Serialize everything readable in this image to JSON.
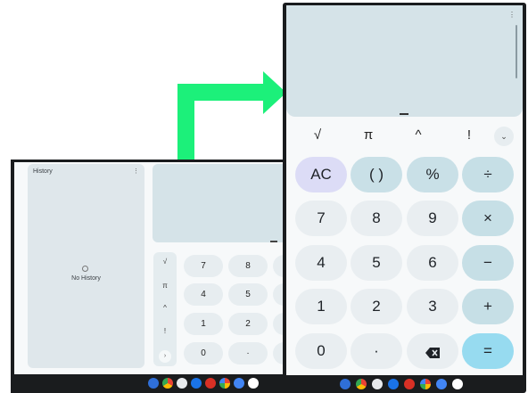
{
  "left_device": {
    "history": {
      "title": "History",
      "menu_icon": "more-vert-icon",
      "empty_icon": "history-icon",
      "empty_text": "No History"
    },
    "scientific": [
      "√",
      "π",
      "^",
      "!"
    ],
    "expand_icon": "chevron-right-icon",
    "expand_glyph": "›",
    "keys": [
      [
        "7",
        "8"
      ],
      [
        "4",
        "5"
      ],
      [
        "1",
        "2"
      ],
      [
        "0",
        "·"
      ]
    ]
  },
  "right_device": {
    "menu_glyph": "⋮",
    "scientific": [
      "√",
      "π",
      "^",
      "!"
    ],
    "collapse_glyph": "⌄",
    "keys": {
      "row1": [
        "AC",
        "( )",
        "%",
        "÷"
      ],
      "row2": [
        "7",
        "8",
        "9",
        "×"
      ],
      "row3": [
        "4",
        "5",
        "6",
        "−"
      ],
      "row4": [
        "1",
        "2",
        "3",
        "+"
      ],
      "row5": [
        "0",
        "·",
        "",
        "="
      ]
    },
    "backspace_icon": "backspace-icon"
  },
  "shelf_apps": [
    "launcher-icon",
    "chrome-icon",
    "files-icon",
    "settings-icon",
    "app-icon",
    "photos-icon",
    "play-store-icon",
    "google-app-icon"
  ],
  "colors": {
    "arrow": "#1cf07a",
    "display": "#d5e3e8",
    "equals": "#97dbf0",
    "ac": "#dcdcf6"
  }
}
